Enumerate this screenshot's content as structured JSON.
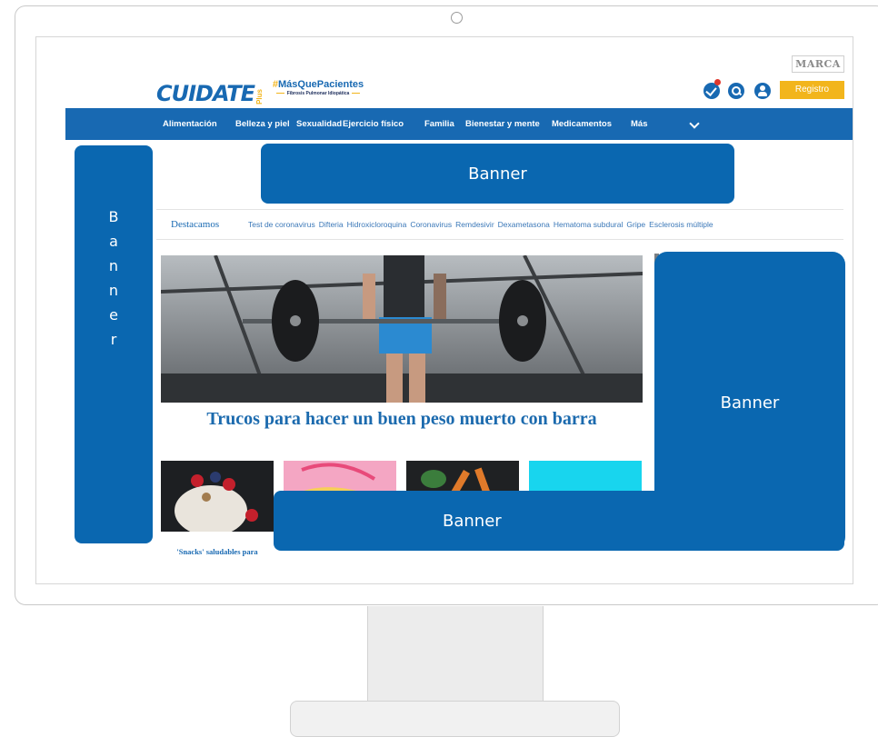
{
  "site": {
    "logo_text": "CUIDATE",
    "logo_plus": "Plus",
    "campaign_hash": "#",
    "campaign_tag": "MásQuePacientes",
    "campaign_sub": "Fibrosis Pulmonar Idiopática",
    "partner_logo": "MARCA",
    "register_label": "Registro"
  },
  "nav": {
    "items": [
      "Alimentación",
      "Belleza y piel",
      "Sexualidad",
      "Ejercicio físico",
      "Familia",
      "Bienestar y mente",
      "Medicamentos"
    ],
    "more_label": "Más"
  },
  "featured": {
    "title": "Destacamos",
    "topics": [
      "Test de coronavirus",
      "Difteria",
      "Hidroxicloroquina",
      "Coronavirus",
      "Remdesivir",
      "Dexametasona",
      "Hematoma subdural",
      "Gripe",
      "Esclerosis múltiple"
    ]
  },
  "hero": {
    "title": "Trucos para hacer un buen peso muerto con barra"
  },
  "thumbs": {
    "first_caption": "'Snacks' saludables para"
  },
  "banners": {
    "top": "Banner",
    "left": "Banner",
    "right": "Banner",
    "bottom": "Banner"
  },
  "colors": {
    "brand_blue": "#1869b2",
    "banner_blue": "#0a67b0",
    "accent_yellow": "#f2b51c"
  }
}
